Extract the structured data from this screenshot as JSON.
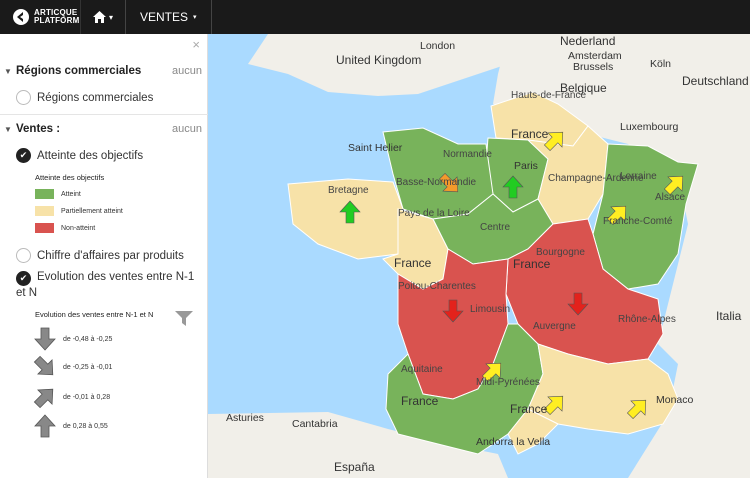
{
  "topbar": {
    "brand_line1": "ARTICQUE",
    "brand_line2": "PLATFORM",
    "home_caret": "▾",
    "menu_label": "VENTES",
    "menu_caret": "▾"
  },
  "sidebar": {
    "close": "×",
    "section1": {
      "title": "Régions commerciales",
      "clear": "aucun",
      "items": [
        "Régions commerciales"
      ]
    },
    "section2": {
      "title": "Ventes :",
      "clear": "aucun",
      "layer1": "Atteinte des objectifs",
      "legend1_title": "Atteinte des objectifs",
      "legend1": [
        {
          "label": "Atteint",
          "color": "#78b35b"
        },
        {
          "label": "Partiellement atteint",
          "color": "#f7e2a8"
        },
        {
          "label": "Non-atteint",
          "color": "#d9534f"
        }
      ],
      "layer2": "Chiffre d'affaires par produits",
      "layer3_line1": "Evolution des ventes entre N-1",
      "layer3_line2": "et N",
      "legend2_title": "Evolution des ventes entre N-1 et N",
      "legend2": [
        {
          "label": "de -0,48 à -0,25",
          "angle": 180
        },
        {
          "label": "de -0,25 à -0,01",
          "angle": 135
        },
        {
          "label": "de -0,01 à 0,28",
          "angle": 45
        },
        {
          "label": "de 0,28 à 0,55",
          "angle": 0
        }
      ]
    }
  },
  "map": {
    "colors": {
      "sea": "#aadaff",
      "land_out": "#f1efe9",
      "atteint": "#78b35b",
      "partiel": "#f7e2a8",
      "non": "#d9534f"
    },
    "countries": {
      "uk": "United Kingdom",
      "nederland": "Nederland",
      "belgique": "Belgique",
      "deutschland": "Deutschland",
      "luxembourg": "Luxembourg",
      "france": "France",
      "italia": "Italia",
      "espana": "España",
      "monaco": "Monaco",
      "andorra": "Andorra la Vella"
    },
    "cities": {
      "london": "London",
      "amsterdam": "Amsterdam",
      "brussels": "Brussels",
      "koln": "Köln",
      "saint_helier": "Saint Helier",
      "paris": "Paris",
      "asturies": "Asturies",
      "cantabria": "Cantabria"
    },
    "regions": {
      "hauts": "Hauts-de-France",
      "normandie": "Normandie",
      "basse_normandie": "Basse-Normandie",
      "bretagne": "Bretagne",
      "pays_loire": "Pays de la Loire",
      "centre": "Centre",
      "champagne": "Champagne-Ardenne",
      "lorraine": "Lorraine",
      "alsace": "Alsace",
      "franche": "Franche-Comté",
      "bourgogne": "Bourgogne",
      "poitou": "Poitou-Charentes",
      "limousin": "Limousin",
      "auvergne": "Auvergne",
      "rhone": "Rhône-Alpes",
      "aquitaine": "Aquitaine",
      "midi": "Midi-Pyrénées"
    },
    "arrow_colors": {
      "up": "#22cc22",
      "up_right": "#ffee22",
      "down_right": "#f39a2b",
      "down": "#e3221c"
    }
  }
}
